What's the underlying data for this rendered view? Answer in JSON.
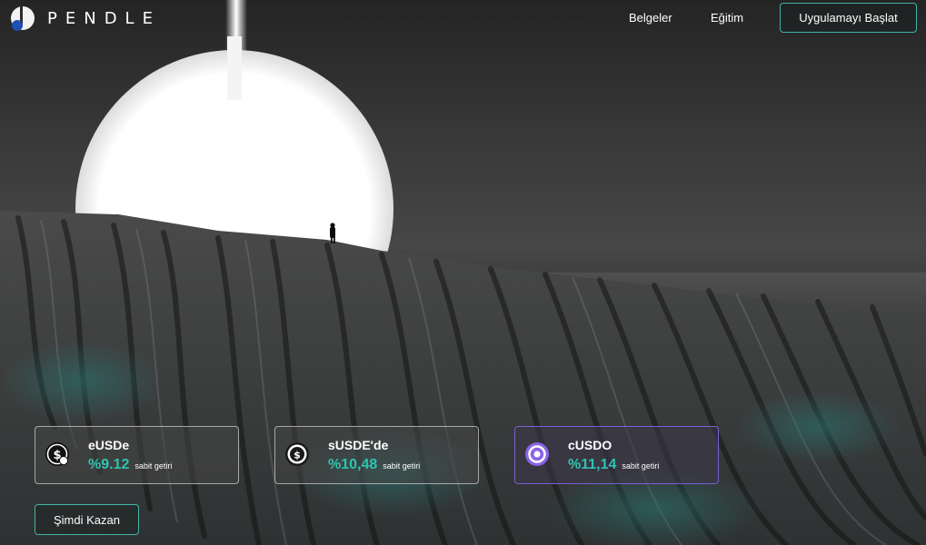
{
  "brand": {
    "name": "PENDLE",
    "logo_icon": "pendle-logo-icon"
  },
  "nav": {
    "links": [
      {
        "label": "Belgeler"
      },
      {
        "label": "Eğitim"
      }
    ],
    "launch_label": "Uygulamayı Başlat"
  },
  "pools": [
    {
      "icon": "eusde-token-icon",
      "name": "eUSDe",
      "apy": "%9.12",
      "apy_label": "sabit getiri"
    },
    {
      "icon": "susde-token-icon",
      "name": "sUSDE'de",
      "apy": "%10,48",
      "apy_label": "sabit getiri"
    },
    {
      "icon": "cusdo-token-icon",
      "name": "cUSDO",
      "apy": "%11,14",
      "apy_label": "sabit getiri"
    }
  ],
  "cta": {
    "earn_label": "Şimdi Kazan"
  },
  "colors": {
    "accent": "#2ec4b0",
    "button_border": "#3fb5a7",
    "purple_border": "#7a5fd3"
  }
}
